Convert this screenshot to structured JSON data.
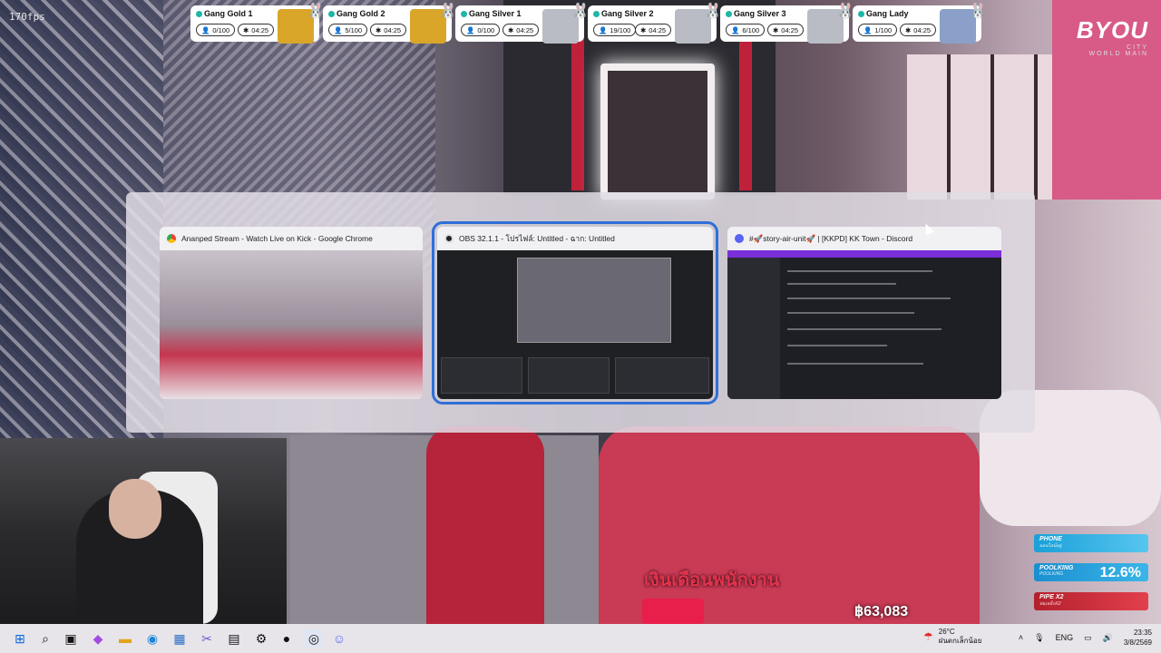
{
  "overlay": {
    "fps": "170fps"
  },
  "gangs": [
    {
      "name": "Gang Gold 1",
      "count": "0/100",
      "time": "04:25",
      "color": "#d9a62a"
    },
    {
      "name": "Gang Gold 2",
      "count": "5/100",
      "time": "04:25",
      "color": "#d9a62a"
    },
    {
      "name": "Gang Silver 1",
      "count": "0/100",
      "time": "04:25",
      "color": "#b9bcc4"
    },
    {
      "name": "Gang Silver 2",
      "count": "19/100",
      "time": "04:25",
      "color": "#b9bcc4"
    },
    {
      "name": "Gang Silver 3",
      "count": "6/100",
      "time": "04:25",
      "color": "#b9bcc4"
    },
    {
      "name": "Gang Lady",
      "count": "1/100",
      "time": "04:25",
      "color": "#8aa0c8"
    }
  ],
  "logo": {
    "main": "BYOU",
    "sub_small": "CITY",
    "sub": "WORLD MAIN"
  },
  "switcher": {
    "windows": [
      {
        "title": "Ananped Stream - Watch Live on Kick - Google Chrome",
        "app": "chrome-icon"
      },
      {
        "title": "OBS 32.1.1 - โปรไฟล์: Untitled - ฉาก: Untitled",
        "app": "obs-icon"
      },
      {
        "title": "#🚀story-air-unit🚀 | [KKPD] KK Town - Discord",
        "app": "discord-icon"
      }
    ]
  },
  "game": {
    "subtitle": "เงินเดือนพนักงาน",
    "money": "฿63,083"
  },
  "hud": {
    "phone": {
      "label": "PHONE",
      "sub": "ออนไลน์อยู่"
    },
    "pooling": {
      "label": "POOLKING",
      "sub": "POOLKING",
      "value": "12.6%"
    },
    "pipe": {
      "label": "PIPE X2",
      "sub": "ท่อเหล็กX2"
    }
  },
  "taskbar": {
    "weather_temp": "26°C",
    "weather_desc": "ฝนตกเล็กน้อย",
    "lang": "ENG",
    "time": "23:35",
    "date": "3/8/2569"
  }
}
